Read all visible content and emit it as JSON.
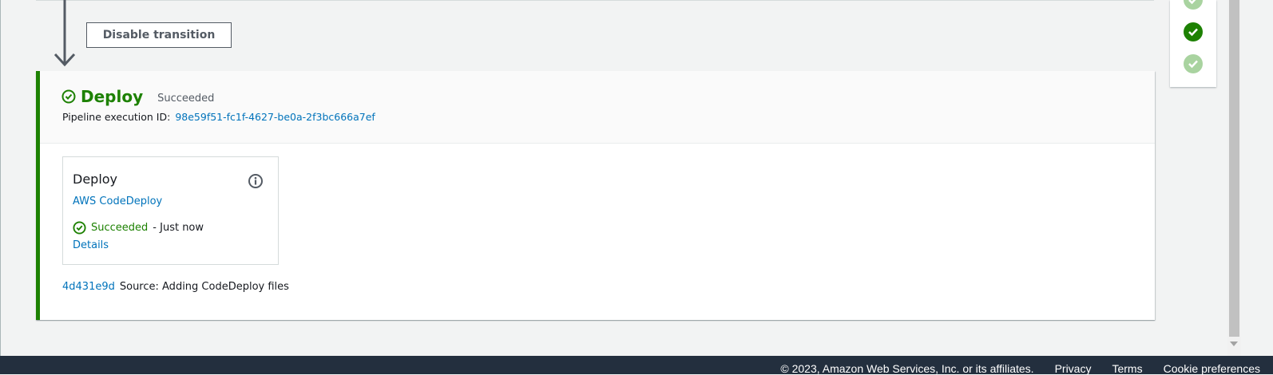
{
  "transition": {
    "button_label": "Disable transition"
  },
  "stage": {
    "name": "Deploy",
    "status": "Succeeded",
    "execution_label": "Pipeline execution ID:",
    "execution_id": "98e59f51-fc1f-4627-be0a-2f3bc666a7ef",
    "accent_color": "#1d8102"
  },
  "action": {
    "name": "Deploy",
    "provider": "AWS CodeDeploy",
    "status": "Succeeded",
    "time": "- Just now",
    "details_label": "Details"
  },
  "commit": {
    "id": "4d431e9d",
    "message": "Source: Adding CodeDeploy files"
  },
  "stage_nav": {
    "items": [
      {
        "state": "succeeded-partial"
      },
      {
        "state": "succeeded-current"
      },
      {
        "state": "succeeded"
      }
    ]
  },
  "footer": {
    "copyright": "© 2023, Amazon Web Services, Inc. or its affiliates.",
    "privacy": "Privacy",
    "terms": "Terms",
    "cookies": "Cookie preferences"
  }
}
